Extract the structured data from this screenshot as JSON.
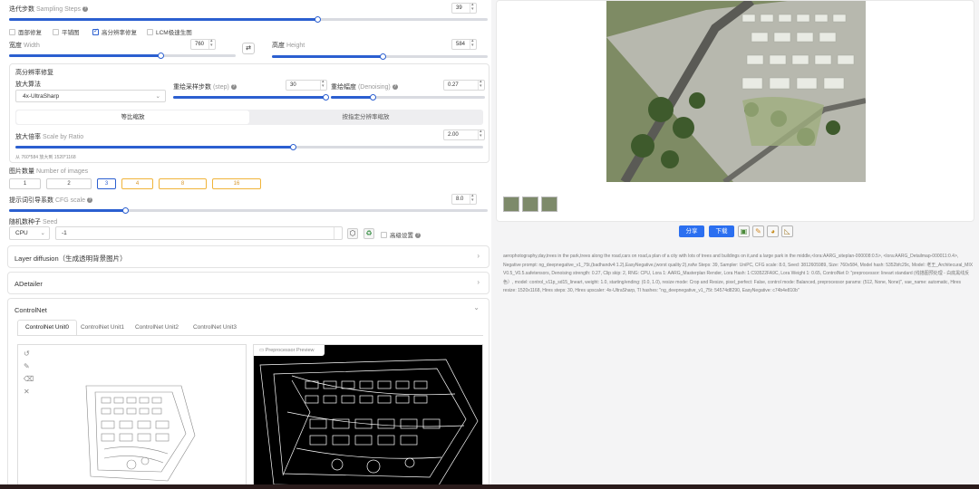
{
  "left": {
    "sampling_steps": {
      "label": "迭代步数",
      "en": "Sampling Steps",
      "value": "39",
      "slider_fraction": 0.64
    },
    "checkboxes": [
      {
        "label": "面部修复",
        "checked": false
      },
      {
        "label": "平铺图",
        "checked": false
      },
      {
        "label": "高分辨率修复",
        "checked": true
      },
      {
        "label": "LCM极速生图",
        "checked": false
      }
    ],
    "width": {
      "label": "宽度",
      "en": "Width",
      "value": "760",
      "slider_fraction": 0.6
    },
    "height": {
      "label": "高度",
      "en": "Height",
      "value": "584",
      "slider_fraction": 0.5
    },
    "swap_icon": "swap-icon",
    "hires": {
      "title": "高分辨率修复",
      "upscaler_label": "放大算法",
      "upscaler_value": "4x-UltraSharp",
      "hires_steps": {
        "label": "重绘采样步数",
        "en": "(step)",
        "value": "30",
        "slider_fraction": 0.99
      },
      "denoising": {
        "label": "重绘幅度",
        "en": "(Denoising)",
        "value": "0.27",
        "slider_fraction": 0.27
      },
      "tab_ratio": "等比缩放",
      "tab_custom": "按指定分辨率缩放",
      "scale": {
        "label": "放大倍率",
        "en": "Scale by Ratio",
        "value": "2.00",
        "slider_fraction": 0.6
      },
      "resize_info": "从 760*584 放大到 1520*1168"
    },
    "batch": {
      "label": "图片数量",
      "en": "Number of images",
      "options": [
        "1",
        "2",
        "3",
        "4",
        "8",
        "16"
      ],
      "selected": "3"
    },
    "cfg": {
      "label": "提示词引导系数",
      "en": "CFG scale",
      "value": "8.0",
      "slider_fraction": 0.25
    },
    "seed": {
      "label": "随机数种子",
      "en": "Seed",
      "device": "CPU",
      "value": "-1",
      "extra_label": "高级设置"
    },
    "accordions": [
      {
        "title": "Layer diffusion（生成透明背景图片）",
        "expanded": false
      },
      {
        "title": "ADetailer",
        "expanded": false
      },
      {
        "title": "ControlNet",
        "expanded": true
      }
    ],
    "controlnet_tabs": [
      "ControlNet Unit0",
      "ControlNet Unit1",
      "ControlNet Unit2",
      "ControlNet Unit3"
    ],
    "preview_label": "Preprocessor Preview"
  },
  "right": {
    "share_label": "分享",
    "download_label": "下载",
    "tool_icons": [
      "image-icon",
      "pencil-icon",
      "palette-icon",
      "ruler-icon"
    ],
    "info_text": "aerophotography,day,trees in the park,trees along the road,cars on road,a plan of a city with lots of trees and buildings on it,and a large park in the middle,<lora:AARG_siteplan-000008:0.5>, <lora:AARG_Detailmap-000011:0.4>, Negative prompt: ng_deepnegative_v1_75t,(badhandv4:1.2),EasyNegative,(worst quality:2),nsfw Steps: 39, Sampler: UniPC, CFG scale: 8.0, Seed: 3812605989, Size: 760x584, Model hash: 5352bfc29c, Model: 老王_Architecural_MIX V0.5_V0.5.safetensors, Denoising strength: 0.27, Clip skip: 2, RNG: CPU, Lora 1: AARG_Masterplan Render, Lora Hash: 1:C93522FA9C, Lora Weight 1: 0.65, ControlNet 0: \"preprocessor: lineart standard (线描图预处理 - 白底黑线反色）, model: control_v11p_sd15_lineart, weight: 1.0, starting/ending: (0.0, 1.0), resize mode: Crop and Resize, pixel_perfect: False, control mode: Balanced, preprocessor params: (512, None, None)\", vae_name: automatic, Hires resize: 1520x1168, Hires steps: 30, Hires upscaler: 4x-UltraSharp, TI hashes: \"ng_deepnegative_v1_75t: 54574d8290, EasyNegative: c74b4e810b\""
  },
  "colors": {
    "accent": "#2b5fd0",
    "orange": "#f0b43a",
    "green": "#2f8a3c"
  }
}
